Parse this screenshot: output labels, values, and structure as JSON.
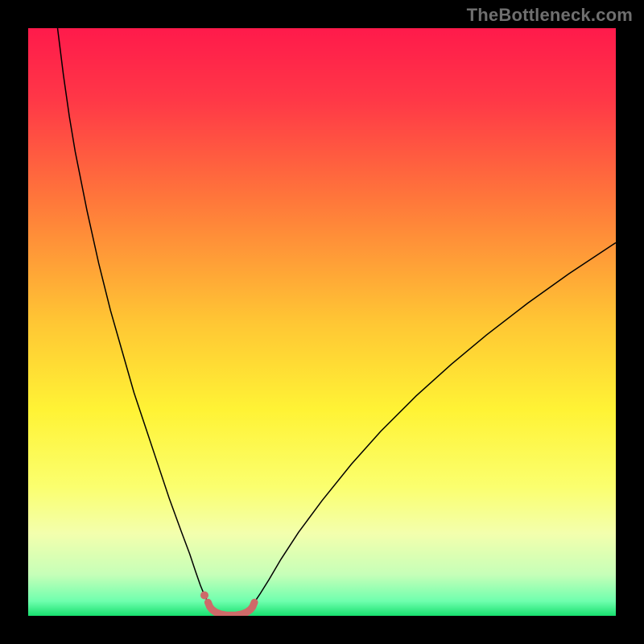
{
  "watermark": {
    "text": "TheBottleneck.com"
  },
  "chart_data": {
    "type": "line",
    "title": "",
    "xlabel": "",
    "ylabel": "",
    "xlim": [
      0,
      100
    ],
    "ylim": [
      0,
      100
    ],
    "grid": false,
    "gradient_stops": [
      {
        "offset": 0.0,
        "color": "#ff1a4b"
      },
      {
        "offset": 0.12,
        "color": "#ff3747"
      },
      {
        "offset": 0.3,
        "color": "#ff7a3a"
      },
      {
        "offset": 0.5,
        "color": "#ffc634"
      },
      {
        "offset": 0.65,
        "color": "#fff335"
      },
      {
        "offset": 0.78,
        "color": "#fbff6e"
      },
      {
        "offset": 0.86,
        "color": "#f3ffad"
      },
      {
        "offset": 0.93,
        "color": "#c6ffb8"
      },
      {
        "offset": 0.975,
        "color": "#6fffae"
      },
      {
        "offset": 1.0,
        "color": "#18e06f"
      }
    ],
    "series": [
      {
        "name": "left-branch",
        "stroke": "#000000",
        "stroke_width": 1.5,
        "x": [
          5,
          6,
          7,
          8,
          10,
          12,
          14,
          16,
          18,
          20,
          22,
          24,
          26,
          27.5,
          28.5,
          29.3,
          30.0,
          30.6
        ],
        "y": [
          100,
          92,
          85,
          79,
          69,
          60,
          52,
          45,
          38,
          32,
          26,
          20,
          14.5,
          10.5,
          7.5,
          5.2,
          3.5,
          2.3
        ]
      },
      {
        "name": "right-branch",
        "stroke": "#000000",
        "stroke_width": 1.5,
        "x": [
          38.5,
          39.5,
          41,
          43,
          46,
          50,
          55,
          60,
          66,
          72,
          78,
          85,
          92,
          100
        ],
        "y": [
          2.3,
          3.8,
          6.2,
          9.6,
          14.2,
          19.6,
          25.8,
          31.4,
          37.4,
          42.8,
          47.8,
          53.2,
          58.2,
          63.5
        ]
      },
      {
        "name": "optimum-band",
        "stroke": "#ce6a69",
        "stroke_width": 9,
        "linecap": "round",
        "x": [
          30.6,
          30.9,
          31.3,
          31.9,
          32.7,
          33.8,
          35.3,
          36.4,
          37.2,
          37.8,
          38.2,
          38.5
        ],
        "y": [
          2.3,
          1.55,
          1.05,
          0.62,
          0.3,
          0.1,
          0.1,
          0.3,
          0.62,
          1.05,
          1.55,
          2.3
        ]
      }
    ],
    "markers": [
      {
        "name": "left-dot",
        "x": 30.0,
        "y": 3.5,
        "r": 5,
        "color": "#ce6a69"
      }
    ]
  }
}
